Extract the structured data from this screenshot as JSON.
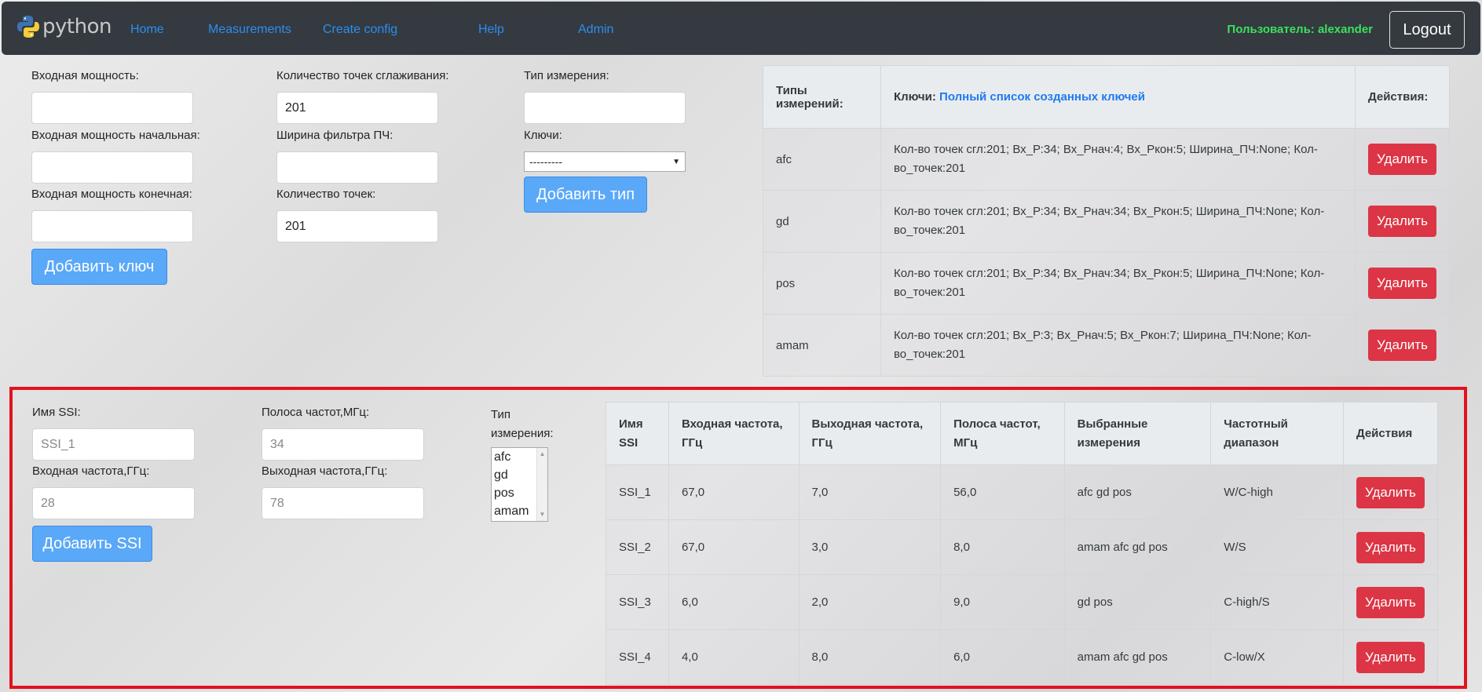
{
  "nav": {
    "brand": "python",
    "links": [
      "Home",
      "Measurements",
      "Create config",
      "Help",
      "Admin"
    ],
    "user": "Пользователь: alexander",
    "logout": "Logout"
  },
  "keyform": {
    "in_power_label": "Входная мощность:",
    "in_power_start_label": "Входная мощность начальная:",
    "in_power_end_label": "Входная мощность конечная:",
    "smooth_label": "Количество точек сглаживания:",
    "smooth_value": "201",
    "if_width_label": "Ширина фильтра ПЧ:",
    "points_label": "Количество точек:",
    "points_value": "201",
    "add_key": "Добавить ключ"
  },
  "typeform": {
    "type_label": "Тип измерения:",
    "keys_label": "Ключи:",
    "keys_selected": "---------",
    "add_type": "Добавить тип"
  },
  "types_table": {
    "headers": [
      "Типы измерений:",
      "Ключи:",
      "Действия:"
    ],
    "keys_link": "Полный список созданных ключей",
    "rows": [
      {
        "type": "afc",
        "keys": "Кол-во точек сгл:201; Вх_Р:34; Вх_Рнач:4; Вх_Ркон:5; Ширина_ПЧ:None; Кол-во_точек:201",
        "action": "Удалить"
      },
      {
        "type": "gd",
        "keys": "Кол-во точек сгл:201; Вх_Р:34; Вх_Рнач:34; Вх_Ркон:5; Ширина_ПЧ:None; Кол-во_точек:201",
        "action": "Удалить"
      },
      {
        "type": "pos",
        "keys": "Кол-во точек сгл:201; Вх_Р:34; Вх_Рнач:34; Вх_Ркон:5; Ширина_ПЧ:None; Кол-во_точек:201",
        "action": "Удалить"
      },
      {
        "type": "amam",
        "keys": "Кол-во точек сгл:201; Вх_Р:3; Вх_Рнач:5; Вх_Ркон:7; Ширина_ПЧ:None; Кол-во_точек:201",
        "action": "Удалить"
      }
    ]
  },
  "ssiform": {
    "name_label": "Имя SSI:",
    "name_placeholder": "SSI_1",
    "in_freq_label": "Входная частота,ГГц:",
    "in_freq_placeholder": "28",
    "band_label": "Полоса частот,МГц:",
    "band_placeholder": "34",
    "out_freq_label": "Выходная частота,ГГц:",
    "out_freq_placeholder": "78",
    "type_label": "Тип измерения:",
    "type_options": [
      "afc",
      "gd",
      "pos",
      "amam"
    ],
    "add_ssi": "Добавить SSI"
  },
  "ssi_table": {
    "headers": [
      "Имя SSI",
      "Входная частота, ГГц",
      "Выходная частота, ГГц",
      "Полоса частот, МГц",
      "Выбранные измерения",
      "Частотный диапазон",
      "Действия"
    ],
    "rows": [
      [
        "SSI_1",
        "67,0",
        "7,0",
        "56,0",
        "afc gd pos",
        "W/C-high",
        "Удалить"
      ],
      [
        "SSI_2",
        "67,0",
        "3,0",
        "8,0",
        "amam afc gd pos",
        "W/S",
        "Удалить"
      ],
      [
        "SSI_3",
        "6,0",
        "2,0",
        "9,0",
        "gd pos",
        "C-high/S",
        "Удалить"
      ],
      [
        "SSI_4",
        "4,0",
        "8,0",
        "6,0",
        "amam afc gd pos",
        "C-low/X",
        "Удалить"
      ]
    ]
  },
  "colors": {
    "navbar": "#343a40",
    "link": "#2b8ef0",
    "user": "#3ce05c",
    "primary": "#5aa8f8",
    "danger": "#dc3545",
    "highlight": "#e3121f"
  }
}
